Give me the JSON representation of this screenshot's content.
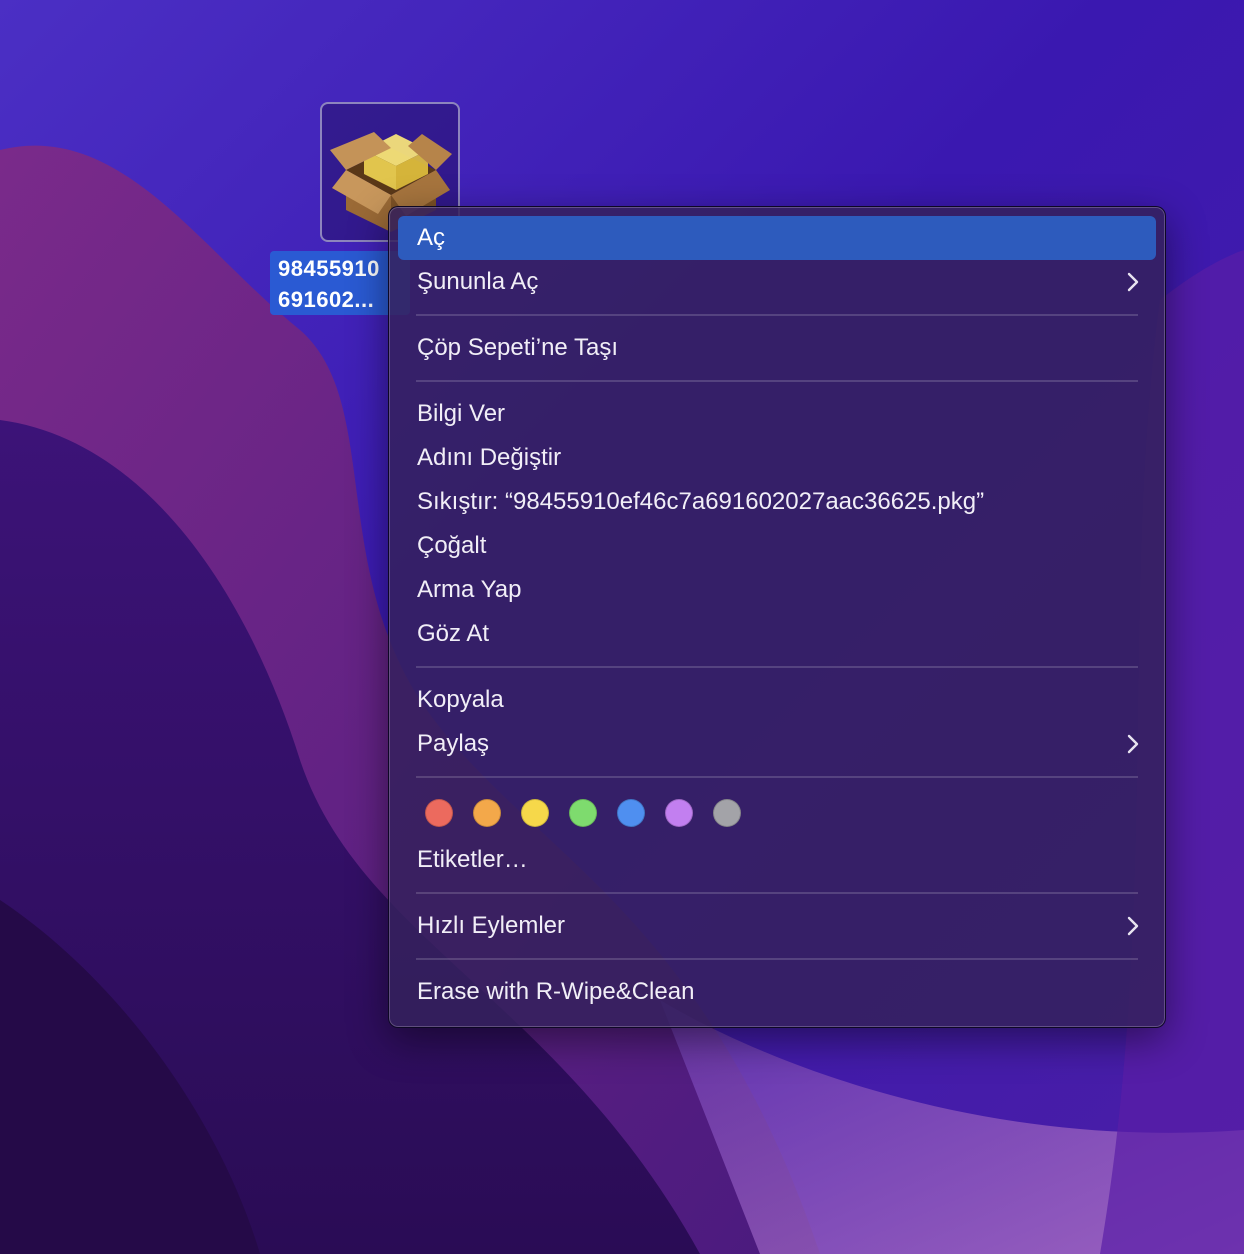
{
  "desktop_file": {
    "name_line1": "98455910",
    "name_line2": "691602...",
    "icon": "package-box-icon"
  },
  "context_menu": {
    "open": "Aç",
    "open_with": "Şununla Aç",
    "move_to_trash": "Çöp Sepeti’ne Taşı",
    "get_info": "Bilgi Ver",
    "rename": "Adını Değiştir",
    "compress": "Sıkıştır: “98455910ef46c7a691602027aac36625.pkg”",
    "duplicate": "Çoğalt",
    "make_alias": "Arma Yap",
    "quick_look": "Göz At",
    "copy": "Kopyala",
    "share": "Paylaş",
    "tags": "Etiketler…",
    "quick_actions": "Hızlı Eylemler",
    "erase": "Erase with R-Wipe&Clean",
    "highlighted_item": "Aç",
    "submenu_icon": "chevron-right-icon"
  },
  "tag_colors": [
    {
      "name": "red",
      "color": "#ec6a5e"
    },
    {
      "name": "orange",
      "color": "#f3a84a"
    },
    {
      "name": "yellow",
      "color": "#f6d84a"
    },
    {
      "name": "green",
      "color": "#7edb6e"
    },
    {
      "name": "blue",
      "color": "#4f8ff0"
    },
    {
      "name": "purple",
      "color": "#c27ff0"
    },
    {
      "name": "gray",
      "color": "#a3a3a8"
    }
  ],
  "colors": {
    "menu_highlight": "#2d5bbd",
    "selection_label": "#2a5ad3"
  }
}
